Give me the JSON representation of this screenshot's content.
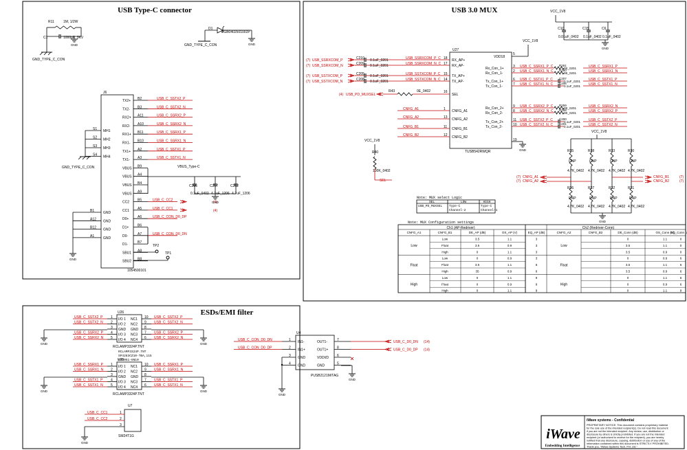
{
  "sections": {
    "usbc": "USB Type-C connector",
    "mux": "USB 3.0 MUX",
    "esd": "ESDs/EMI filter"
  },
  "usbc": {
    "r11": "R11",
    "r11v": "1M, 1/2W",
    "c1": "C1",
    "c1v": "1000pF_3KV",
    "gnd_conn": "GND_TYPE_C_CON",
    "gnd": "GND",
    "d1": "D1",
    "d1v": "PGB0402501002P",
    "j": "J6",
    "jpart": "1054500101",
    "left_pins": [
      {
        "n": "S1",
        "p": "MH1"
      },
      {
        "n": "S2",
        "p": "MH2"
      },
      {
        "n": "S3",
        "p": "MH3"
      },
      {
        "n": "S4",
        "p": "MH4"
      }
    ],
    "gnd_pins": [
      {
        "n": "B1",
        "p": "GND"
      },
      {
        "n": "A12",
        "p": "GND"
      },
      {
        "n": "B12",
        "p": "GND"
      },
      {
        "n": "A1",
        "p": "GND"
      }
    ],
    "pins": [
      {
        "p": "TX2+",
        "n": "B2",
        "net": "USB_C_SSTX2_P"
      },
      {
        "p": "TX2-",
        "n": "B3",
        "net": "USB_C_SSTX2_N"
      },
      {
        "p": "RX2+",
        "n": "A11",
        "net": "USB_C_SSRX2_P"
      },
      {
        "p": "RX2-",
        "n": "A10",
        "net": "USB_C_SSRX2_N"
      },
      {
        "p": "RX1+",
        "n": "B11",
        "net": "USB_C_SSRX1_P"
      },
      {
        "p": "RX1-",
        "n": "B10",
        "net": "USB_C_SSRX1_N"
      },
      {
        "p": "TX1+",
        "n": "A2",
        "net": "USB_C_SSTX1_P"
      },
      {
        "p": "TX1-",
        "n": "A3",
        "net": "USB_C_SSTX1_N"
      },
      {
        "p": "VBUS",
        "n": "B9",
        "net": ""
      },
      {
        "p": "VBUS",
        "n": "A4",
        "net": ""
      },
      {
        "p": "VBUS",
        "n": "B4",
        "net": ""
      },
      {
        "p": "VBUS",
        "n": "A9",
        "net": ""
      },
      {
        "p": "CC2",
        "n": "B5",
        "net": "USB_C_CC2"
      },
      {
        "p": "CC1",
        "n": "A5",
        "net": "USB_C_CC1"
      },
      {
        "p": "D0+",
        "n": "A6",
        "net": "USB_C_CON_D0_DP"
      },
      {
        "p": "D1+",
        "n": "B6",
        "net": ""
      },
      {
        "p": "D0-",
        "n": "A7",
        "net": "USB_C_CON_D0_DN"
      },
      {
        "p": "D1-",
        "n": "B7",
        "net": ""
      },
      {
        "p": "SBU1",
        "n": "A8",
        "net": ""
      },
      {
        "p": "SBU2",
        "n": "B8",
        "net": ""
      }
    ],
    "vbus": "VBUS_Type-C",
    "ref4": "(4)",
    "caps": [
      {
        "r": "C206",
        "v": "0.1uF_0402"
      },
      {
        "r": "C217",
        "v": "4.7uF_1206"
      },
      {
        "r": "C212",
        "v": "4.7uF_1206"
      }
    ],
    "tp": [
      "TP2",
      "TP1"
    ]
  },
  "mux": {
    "vcc": "VCC_1V8",
    "caps": [
      {
        "r": "C10",
        "v": "0.01uF_0402"
      },
      {
        "r": "C15",
        "v": "0.1uF_0402"
      },
      {
        "r": "C6",
        "v": "0.1uF_0402"
      }
    ],
    "u": "U27",
    "upart": "TUSB542RWQR",
    "inputs": [
      {
        "ref": "(7)",
        "net": "USB_SSRXCOM_P",
        "c": "C210",
        "cv": "0.1uF_0201",
        "mid": "USB_SSRXCOM_P_C",
        "pin": "18",
        "pn": "RX_AP+"
      },
      {
        "ref": "(7)",
        "net": "USB_SSRXCOM_N",
        "c": "C209",
        "cv": "0.1uF_0201",
        "mid": "USB_SSRXCOM_N_C",
        "pin": "17",
        "pn": "RX_AP-"
      },
      {
        "ref": "(7)",
        "net": "USB_SSTXCOM_P",
        "c": "C205",
        "cv": "0.1uF_0201",
        "mid": "USB_SSTXCOM_P_C",
        "pin": "15",
        "pn": "TX_AP+"
      },
      {
        "ref": "(7)",
        "net": "USB_SSTXCOM_N",
        "c": "C208",
        "cv": "0.1uF_0201",
        "mid": "USB_SSTXCOM_N_C",
        "pin": "14",
        "pn": "TX_AP-"
      }
    ],
    "sel": {
      "ref": "(4)",
      "net": "USB_PD_MUXSEL",
      "r": "R43",
      "rv": "0E_0402",
      "mid": "SEL",
      "pin": "16",
      "pn": "SEL"
    },
    "cfg": [
      {
        "net": "CNFG_A1",
        "pin": "1",
        "pn": "CNFG_A1"
      },
      {
        "net": "CNFG_A2",
        "pin": "13",
        "pn": "CNFG_A2"
      },
      {
        "net": "CNFG_B1",
        "pin": "11",
        "pn": "CNFG_B1"
      },
      {
        "net": "CNFG_B2",
        "pin": "12",
        "pn": "CNFG_B2"
      }
    ],
    "vdd": {
      "pin": "5",
      "pn": "VDD18"
    },
    "gnd": {
      "pin": "19",
      "pn": "GND"
    },
    "outputs": [
      {
        "pn": "Rx_Con_1+",
        "pin": "3",
        "mid": "USB_C_SSRX1_P_C",
        "r": "R261",
        "rv": "0E_0201",
        "net": "USB_C_SSRX1_P"
      },
      {
        "pn": "Rx_Con_1-",
        "pin": "2",
        "mid": "USB_C_SSRX1_N_C",
        "r": "R260",
        "rv": "0E_0201",
        "net": "USB_C_SSRX1_N"
      },
      {
        "pn": "Tx_Con_1+",
        "pin": "6",
        "mid": "USB_C_SSTX1_P_C",
        "r": "C207",
        "rv": "0.1uF_0201",
        "net": "USB_C_SSTX1_P"
      },
      {
        "pn": "Tx_Con_1-",
        "pin": "7",
        "mid": "USB_C_SSTX1_N_C",
        "r": "C206",
        "rv": "0.1uF_0201",
        "net": "USB_C_SSTX1_N"
      },
      {
        "pn": "Rx_Con_2+",
        "pin": "9",
        "mid": "USB_C_SSRX2_P_C",
        "r": "R259",
        "rv": "0E_0201",
        "net": "USB_C_SSRX2_N"
      },
      {
        "pn": "Rx_Con_2-",
        "pin": "8",
        "mid": "USB_C_SSRX2_N_C",
        "r": "R258",
        "rv": "0E_0201",
        "net": "USB_C_SSRX2_P"
      },
      {
        "pn": "Tx_Con_2+",
        "pin": "11",
        "mid": "USB_C_SSTX2_P_C",
        "r": "C200",
        "rv": "0.1uF_0201",
        "net": "USB_C_SSTX2_P"
      },
      {
        "pn": "Tx_Con_2-",
        "pin": "10",
        "mid": "USB_C_SSTX2_N_C",
        "r": "C201",
        "rv": "0.1uF_0201",
        "net": "USB_C_SSTX2_N"
      }
    ],
    "r40": "R40",
    "r40v": "100K_0402",
    "sel_label": "SEL",
    "res_top": [
      {
        "r": "R35",
        "v": "DNP"
      },
      {
        "r": "R38",
        "v": "DNP"
      },
      {
        "r": "R33",
        "v": "DNP"
      },
      {
        "r": "R30",
        "v": "DNP"
      }
    ],
    "res_top_v": [
      "4.7K_0402",
      "4.7K_0402",
      "4.7K_0402",
      "4.7K_0402"
    ],
    "res_bot": [
      {
        "r": "R36",
        "v": "DNP"
      },
      {
        "r": "R37",
        "v": "DNP"
      },
      {
        "r": "R32",
        "v": "DNP"
      },
      {
        "r": "R31",
        "v": "DNP"
      }
    ],
    "res_bot_v": [
      "4.7K_0402",
      "4.7K_0402",
      "4.7K_0402",
      "4.7K_0402"
    ],
    "cfg_left": [
      {
        "ref": "(7)",
        "net": "CNFG_A1"
      },
      {
        "ref": "(7)",
        "net": "CNFG_A2"
      }
    ],
    "cfg_right": [
      {
        "ref": "(7)",
        "net": "CNFG_B1"
      },
      {
        "ref": "(7)",
        "net": "CNFG_B2"
      }
    ],
    "note1": "Note: MUX select Logic",
    "sel_table": {
      "head": [
        "SEL",
        "LOW",
        "HIGH"
      ],
      "rows": [
        [
          "USB_PD_MUXSEL",
          "Type-C\nChannel-2",
          "Type-C\nChannel-1"
        ]
      ]
    },
    "note2": "Note: MUX Configuration settings",
    "cfg_table": {
      "group1": "Ch1 (AP-Redriver)",
      "group2": "Ch2 (Redriver-Conn)",
      "head": [
        "CNFG_A1",
        "CNFG_B1",
        "DE_AP (dB)",
        "OS_AP (V)",
        "EQ_AP (dB)",
        "CNFG_A2",
        "CNFG_B2",
        "DE_Conn (dB)",
        "OS_Conn (V)",
        "EQ_Conn (dB)"
      ],
      "groups": [
        "Low",
        "Float",
        "High"
      ],
      "rows": [
        [
          "Low",
          "3.5",
          "1.1",
          "3",
          "Low",
          "0",
          "1.1",
          "0"
        ],
        [
          "Float",
          "3.5",
          "0.9",
          "3",
          "Float",
          "3.5",
          "1.1",
          "0"
        ],
        [
          "High",
          "0",
          "1.1",
          "3",
          "High",
          "3.5",
          "0.9",
          "0"
        ],
        [
          "Low",
          "0",
          "0.9",
          "3",
          "Low",
          "0",
          "0.9",
          "6"
        ],
        [
          "Float",
          "3.5",
          "1.1",
          "6",
          "Float",
          "3.5",
          "1.1",
          "6"
        ],
        [
          "High",
          "35",
          "0.9",
          "6",
          "High",
          "3.5",
          "0.9",
          "6"
        ],
        [
          "Low",
          "0",
          "1.1",
          "9",
          "Low",
          "0",
          "1.1",
          "6"
        ],
        [
          "Float",
          "0",
          "0.9",
          "9",
          "Float",
          "0",
          "0.9",
          "6"
        ],
        [
          "High",
          "0",
          "1.1",
          "9",
          "High",
          "0",
          "1.1",
          "9"
        ]
      ]
    }
  },
  "esd": {
    "u1": "U26",
    "u1part": "RCLAMP3324P.TNT",
    "u2": "U25",
    "u2part": "RCLAMP3324P.TNT",
    "alt": [
      "RCLAMP3324P.TNT",
      "SP4283CZ10-TBA,115",
      "ESD051-6N10"
    ],
    "u1_left": [
      {
        "net": "USB_C_SSTX2_P",
        "pin": "1",
        "pn": "I/O 1"
      },
      {
        "net": "USB_C_SSTX2_N",
        "pin": "2",
        "pn": "I/O 2"
      },
      {
        "net": "",
        "pin": "3",
        "pn": "GND"
      },
      {
        "net": "USB_C_SSRX2_P",
        "pin": "4",
        "pn": "I/O 3"
      },
      {
        "net": "USB_C_SSRX2_N",
        "pin": "5",
        "pn": "I/O 4"
      }
    ],
    "u1_right": [
      {
        "net": "USB_C_SSTX2_P",
        "pin": "10",
        "pn": "NC1"
      },
      {
        "net": "USB_C_SSTX2_N",
        "pin": "9",
        "pn": "NC2"
      },
      {
        "net": "",
        "pin": "8",
        "pn": "GND"
      },
      {
        "net": "USB_C_SSRX2_P",
        "pin": "7",
        "pn": "NC3"
      },
      {
        "net": "USB_C_SSRX2_N",
        "pin": "6",
        "pn": "NC4"
      }
    ],
    "u2_left": [
      {
        "net": "USB_C_SSRX1_P",
        "pin": "1",
        "pn": "I/O 1"
      },
      {
        "net": "USB_C_SSRX1_N",
        "pin": "2",
        "pn": "I/O 2"
      },
      {
        "net": "",
        "pin": "3",
        "pn": "GND"
      },
      {
        "net": "USB_C_SSTX1_P",
        "pin": "4",
        "pn": "I/O 3"
      },
      {
        "net": "USB_C_SSTX1_N",
        "pin": "5",
        "pn": "I/O 4"
      }
    ],
    "u2_right": [
      {
        "net": "USB_C_SSRX1_P",
        "pin": "10",
        "pn": "NC1"
      },
      {
        "net": "USB_C_SSRX1_N",
        "pin": "9",
        "pn": "NC2"
      },
      {
        "net": "",
        "pin": "8",
        "pn": "GND"
      },
      {
        "net": "USB_C_SSTX1_P",
        "pin": "7",
        "pn": "NC3"
      },
      {
        "net": "USB_C_SSTX1_N",
        "pin": "6",
        "pn": "NC4"
      }
    ],
    "u4": "U4",
    "u4part": "PUSB2121M/TAG",
    "u4_left": [
      {
        "net": "USB_C_CON_D0_DN",
        "pin": "1",
        "pn": "IN1-"
      },
      {
        "net": "USB_C_CON_D0_DP",
        "pin": "2",
        "pn": "IN1+"
      },
      {
        "net": "",
        "pin": "3",
        "pn": "GND"
      },
      {
        "net": "",
        "pin": "4",
        "pn": "GND"
      }
    ],
    "u4_right": [
      {
        "net": "USB_C_D0_DN",
        "pin": "7",
        "pn": "OUT1-",
        "ref": "(14)"
      },
      {
        "net": "USB_C_D0_DP",
        "pin": "8",
        "pn": "OUT1+",
        "ref": "(14)"
      },
      {
        "net": "",
        "pin": "6",
        "pn": "VDDI/D"
      },
      {
        "net": "",
        "pin": "5",
        "pn": "GND"
      }
    ],
    "u7": "U7",
    "u7part": "SM24T1G",
    "u7_pins": [
      {
        "net": "USB_C_CC1",
        "pin": "1"
      },
      {
        "net": "USB_C_CC2",
        "pin": "2"
      },
      {
        "net": "",
        "pin": "3"
      }
    ],
    "gnd": "GND"
  },
  "footer": {
    "brand": "iWave",
    "tagline": "Embedding Intelligence",
    "company": "iWave systems - Confidential",
    "notice": [
      "PROPRIETARY NOTICE: This document contains proprietary material",
      "for the sole use of the intended recipient(s). Do not read this document",
      "if you are not the intended recipient. Any review, use, distribution or",
      "disclosure by others is strictly prohibited. If you are not the intended",
      "recipient (or authorized to receive for the recipient), you are hereby",
      "notified that any disclosure, copying, distribution or use of any of the",
      "information contained within this document is STRICTLY PROHIBITED.",
      "Thank you. \"iWave Systems Tech. Pvt. Ltd.\""
    ]
  },
  "colors": {
    "wire": "#000000",
    "net": "#c00000",
    "accent": "#2a8a3a"
  }
}
